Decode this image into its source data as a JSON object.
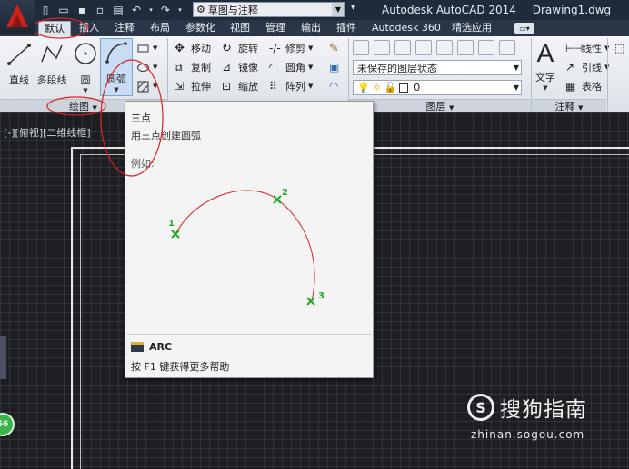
{
  "quick_access": {
    "workspace": "草图与注释",
    "icons": [
      "new-file-icon",
      "open-file-icon",
      "save-icon",
      "save-as-icon",
      "print-icon",
      "undo-icon",
      "redo-icon"
    ]
  },
  "title": {
    "app": "Autodesk AutoCAD 2014",
    "file": "Drawing1.dwg"
  },
  "tabs": [
    {
      "label": "默认",
      "active": true
    },
    {
      "label": "插入"
    },
    {
      "label": "注释"
    },
    {
      "label": "布局"
    },
    {
      "label": "参数化"
    },
    {
      "label": "视图"
    },
    {
      "label": "管理"
    },
    {
      "label": "输出"
    },
    {
      "label": "插件"
    },
    {
      "label": "Autodesk 360"
    },
    {
      "label": "精选应用"
    }
  ],
  "draw_panel": {
    "footer": "绘图",
    "line": "直线",
    "polyline": "多段线",
    "circle": "圆",
    "arc": "圆弧"
  },
  "modify_panel": {
    "move": "移动",
    "rotate": "旋转",
    "trim": "修剪",
    "copy": "复制",
    "mirror": "镜像",
    "fillet": "圆角",
    "stretch": "拉伸",
    "scale": "缩放",
    "array": "阵列"
  },
  "layer_panel": {
    "footer": "图层",
    "layer_state": "未保存的图层状态",
    "current_layer": "0"
  },
  "annotation_panel": {
    "footer": "注释",
    "text": "文字",
    "dimension": "线性",
    "leader": "引线",
    "table": "表格"
  },
  "tooltip": {
    "title": "三点",
    "description": "用三点创建圆弧",
    "example": "例如:",
    "point_labels": [
      "1",
      "2",
      "3"
    ],
    "command": "ARC",
    "help": "按 F1 键获得更多帮助"
  },
  "canvas": {
    "viewport_label": "[-][俯视][二维线框]",
    "badge": "56"
  },
  "watermark": {
    "name": "搜狗指南",
    "url": "zhinan.sogou.com"
  },
  "colors": {
    "arc": "#e02020",
    "points": "#22aa22",
    "highlight": "#e02020"
  }
}
